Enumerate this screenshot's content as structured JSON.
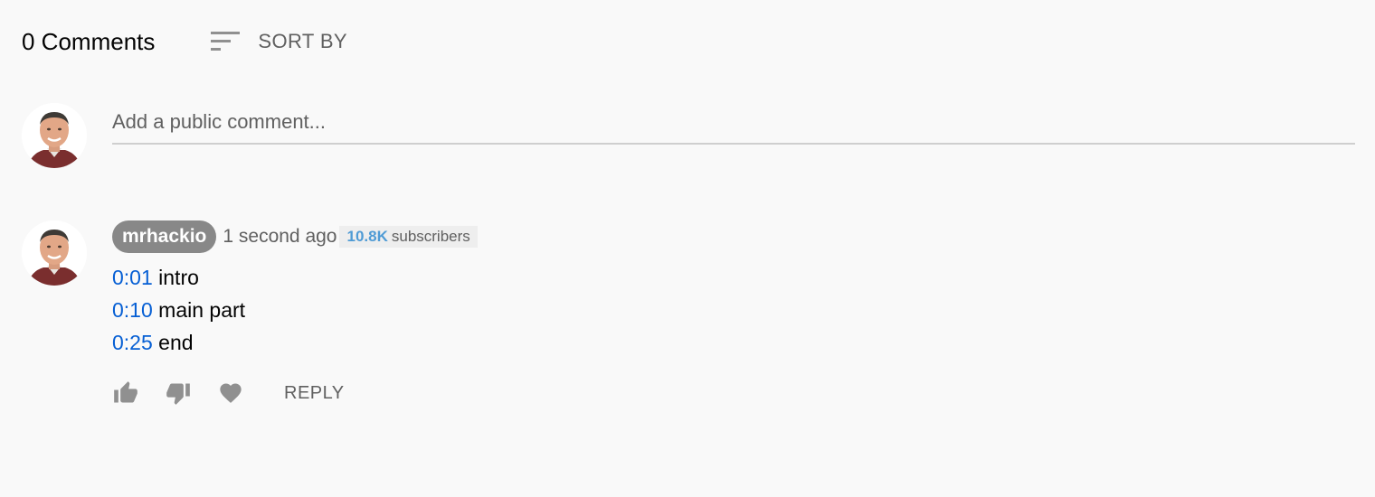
{
  "header": {
    "count_label": "0 Comments",
    "sort_label": "SORT BY",
    "sort_icon": "sort-icon"
  },
  "composer": {
    "placeholder": "Add a public comment...",
    "value": ""
  },
  "comment": {
    "author": "mrhackio",
    "time": "1 second ago",
    "subscriber_count": "10.8K",
    "subscriber_label": "subscribers",
    "lines": [
      {
        "timestamp": "0:01",
        "text": " intro"
      },
      {
        "timestamp": "0:10",
        "text": " main part"
      },
      {
        "timestamp": "0:25",
        "text": " end"
      }
    ]
  },
  "actions": {
    "like_icon": "thumbs-up-icon",
    "dislike_icon": "thumbs-down-icon",
    "heart_icon": "heart-icon",
    "reply_label": "REPLY"
  },
  "colors": {
    "background": "#f9f9f9",
    "link": "#065fd4",
    "secondary_text": "#606060",
    "author_chip": "#888888",
    "subscriber_accent": "#4f9bd5"
  }
}
